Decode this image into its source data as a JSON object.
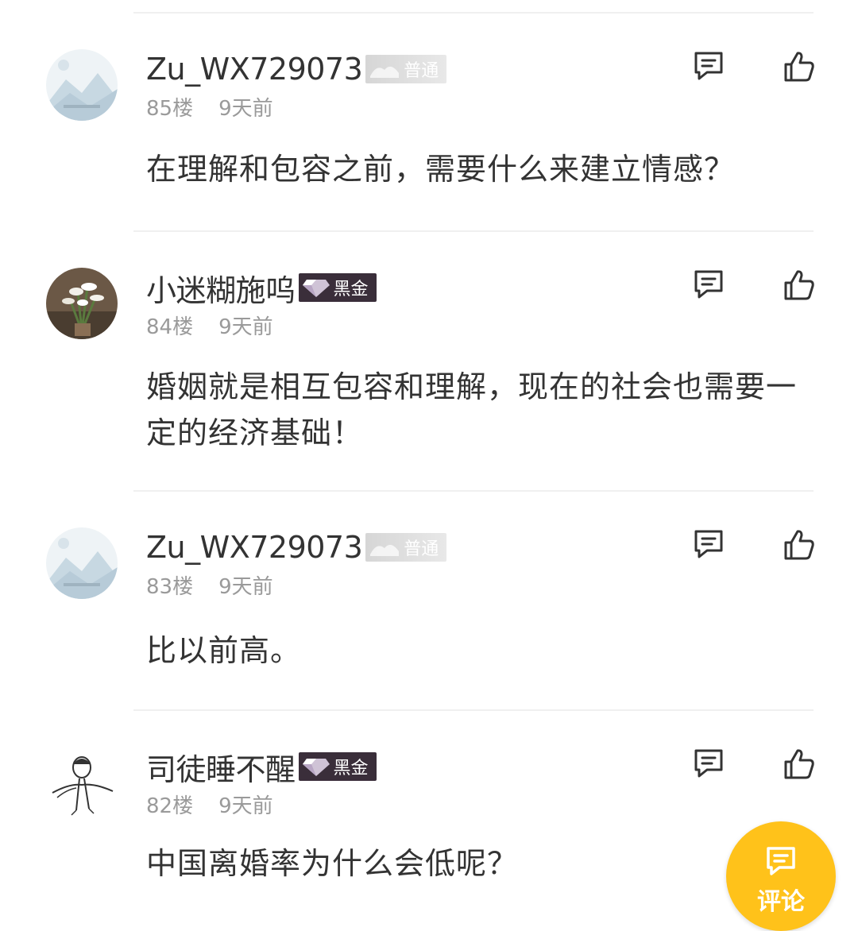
{
  "comments": [
    {
      "username": "Zu_WX729073",
      "badge": "普通",
      "floor": "85楼",
      "time": "9天前",
      "text": "在理解和包容之前，需要什么来建立情感？",
      "avatar": "mountain-placeholder-avatar"
    },
    {
      "username": "小迷糊施呜",
      "badge": "黑金",
      "floor": "84楼",
      "time": "9天前",
      "text": "婚姻就是相互包容和理解，现在的社会也需要一定的经济基础！",
      "avatar": "flower-photo-avatar"
    },
    {
      "username": "Zu_WX729073",
      "badge": "普通",
      "floor": "83楼",
      "time": "9天前",
      "text": "比以前高。",
      "avatar": "mountain-placeholder-avatar"
    },
    {
      "username": "司徒睡不醒",
      "badge": "黑金",
      "floor": "82楼",
      "time": "9天前",
      "text": "中国离婚率为什么会低呢？",
      "avatar": "sketch-figure-avatar"
    }
  ],
  "actions": {
    "reply_icon": "reply-icon",
    "like_icon": "thumbs-up-icon"
  },
  "fab": {
    "label": "评论",
    "icon": "comment-icon",
    "color": "#ffc21a"
  },
  "colors": {
    "text": "#333333",
    "meta": "#9a9a9a",
    "badge_normal": "#d6d6d6",
    "badge_black": "#3a2e3a"
  }
}
